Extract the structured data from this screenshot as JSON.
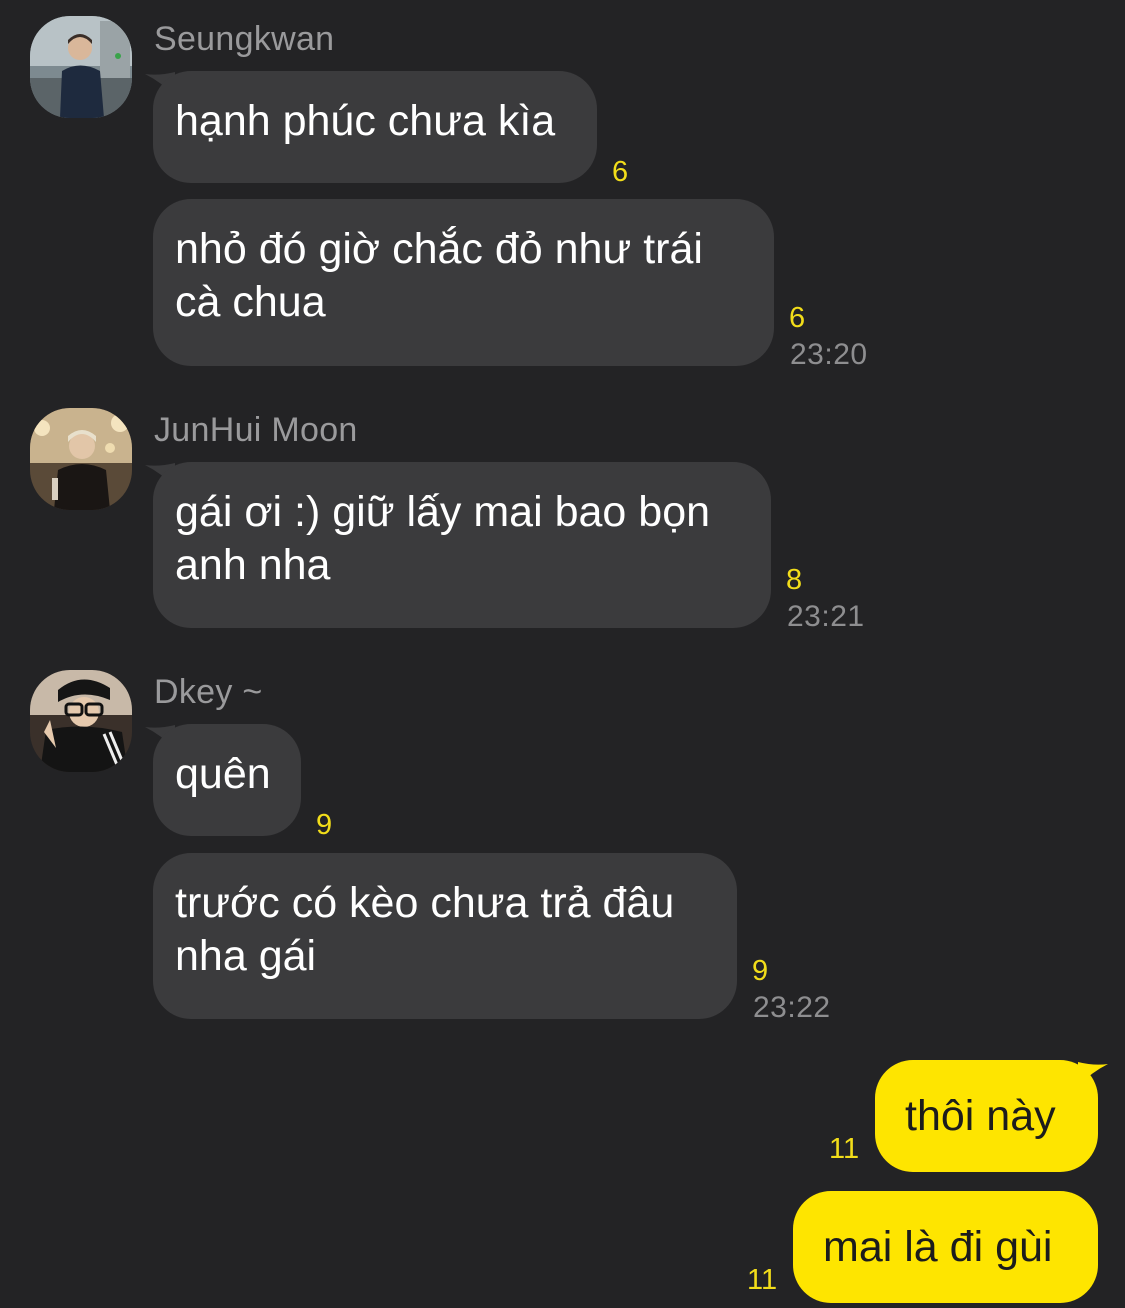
{
  "theme": {
    "background": "#232325",
    "incoming_bubble": "#3b3b3d",
    "outgoing_bubble": "#fee500",
    "unread_color": "#f2dd1a"
  },
  "groups": [
    {
      "sender": "Seungkwan",
      "messages": [
        {
          "text": "hạnh phúc chưa kìa",
          "unread": "6"
        },
        {
          "text": "nhỏ đó giờ chắc đỏ như trái cà chua",
          "unread": "6",
          "time": "23:20"
        }
      ]
    },
    {
      "sender": "JunHui Moon",
      "messages": [
        {
          "text": "gái ơi :) giữ lấy mai bao bọn anh nha",
          "unread": "8",
          "time": "23:21"
        }
      ]
    },
    {
      "sender": "Dkey ~",
      "messages": [
        {
          "text": "quên",
          "unread": "9"
        },
        {
          "text": "trước có kèo chưa trả đâu nha gái",
          "unread": "9",
          "time": "23:22"
        }
      ]
    }
  ],
  "outgoing": [
    {
      "text": "thôi này",
      "unread": "11"
    },
    {
      "text": "mai là đi gùi",
      "unread": "11"
    }
  ]
}
